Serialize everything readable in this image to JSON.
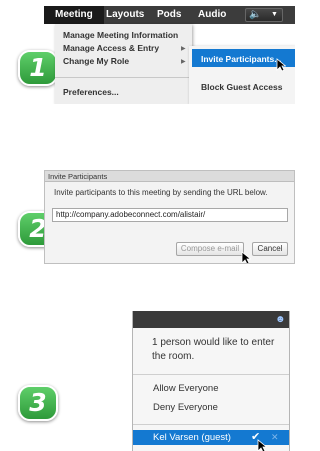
{
  "steps": [
    "1",
    "2",
    "3"
  ],
  "menubar": {
    "items": [
      "Meeting",
      "Layouts",
      "Pods",
      "Audio"
    ]
  },
  "meeting_menu": {
    "items": [
      {
        "label": "Manage Meeting Information"
      },
      {
        "label": "Manage Access & Entry"
      },
      {
        "label": "Change My Role"
      },
      {
        "label": "Preferences..."
      }
    ]
  },
  "access_submenu": {
    "items": [
      {
        "label": "Invite Participants..."
      },
      {
        "label": "Block Guest Access"
      }
    ]
  },
  "invite_dialog": {
    "title": "Invite Participants",
    "message": "Invite participants to this meeting by sending the URL below.",
    "url": "http://company.adobeconnect.com/alistair/",
    "compose_label": "Compose e-mail",
    "cancel_label": "Cancel"
  },
  "entry_notice": {
    "message": "1 person would like to enter the room.",
    "allow_label": "Allow Everyone",
    "deny_label": "Deny Everyone",
    "guest_name": "Kel Varsen (guest)"
  },
  "colors": {
    "badge_green": "#3cae48",
    "highlight_blue": "#1479d1",
    "menubar_dark": "#3c3c3c"
  },
  "icons": {
    "audio": "speaker-icon",
    "user": "user-icon",
    "accept": "check-icon",
    "reject": "close-icon"
  }
}
